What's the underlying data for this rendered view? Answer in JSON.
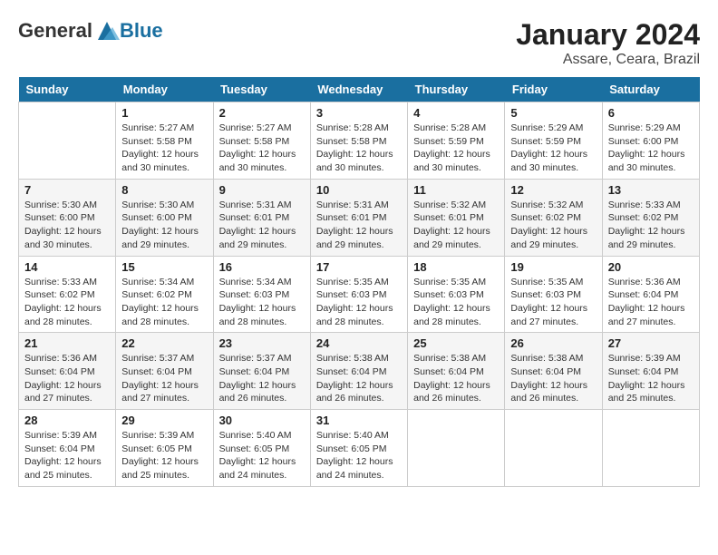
{
  "header": {
    "logo_general": "General",
    "logo_blue": "Blue",
    "month_year": "January 2024",
    "location": "Assare, Ceara, Brazil"
  },
  "days_of_week": [
    "Sunday",
    "Monday",
    "Tuesday",
    "Wednesday",
    "Thursday",
    "Friday",
    "Saturday"
  ],
  "weeks": [
    [
      {
        "day": "",
        "info": ""
      },
      {
        "day": "1",
        "info": "Sunrise: 5:27 AM\nSunset: 5:58 PM\nDaylight: 12 hours and 30 minutes."
      },
      {
        "day": "2",
        "info": "Sunrise: 5:27 AM\nSunset: 5:58 PM\nDaylight: 12 hours and 30 minutes."
      },
      {
        "day": "3",
        "info": "Sunrise: 5:28 AM\nSunset: 5:58 PM\nDaylight: 12 hours and 30 minutes."
      },
      {
        "day": "4",
        "info": "Sunrise: 5:28 AM\nSunset: 5:59 PM\nDaylight: 12 hours and 30 minutes."
      },
      {
        "day": "5",
        "info": "Sunrise: 5:29 AM\nSunset: 5:59 PM\nDaylight: 12 hours and 30 minutes."
      },
      {
        "day": "6",
        "info": "Sunrise: 5:29 AM\nSunset: 6:00 PM\nDaylight: 12 hours and 30 minutes."
      }
    ],
    [
      {
        "day": "7",
        "info": "Sunrise: 5:30 AM\nSunset: 6:00 PM\nDaylight: 12 hours and 30 minutes."
      },
      {
        "day": "8",
        "info": "Sunrise: 5:30 AM\nSunset: 6:00 PM\nDaylight: 12 hours and 29 minutes."
      },
      {
        "day": "9",
        "info": "Sunrise: 5:31 AM\nSunset: 6:01 PM\nDaylight: 12 hours and 29 minutes."
      },
      {
        "day": "10",
        "info": "Sunrise: 5:31 AM\nSunset: 6:01 PM\nDaylight: 12 hours and 29 minutes."
      },
      {
        "day": "11",
        "info": "Sunrise: 5:32 AM\nSunset: 6:01 PM\nDaylight: 12 hours and 29 minutes."
      },
      {
        "day": "12",
        "info": "Sunrise: 5:32 AM\nSunset: 6:02 PM\nDaylight: 12 hours and 29 minutes."
      },
      {
        "day": "13",
        "info": "Sunrise: 5:33 AM\nSunset: 6:02 PM\nDaylight: 12 hours and 29 minutes."
      }
    ],
    [
      {
        "day": "14",
        "info": "Sunrise: 5:33 AM\nSunset: 6:02 PM\nDaylight: 12 hours and 28 minutes."
      },
      {
        "day": "15",
        "info": "Sunrise: 5:34 AM\nSunset: 6:02 PM\nDaylight: 12 hours and 28 minutes."
      },
      {
        "day": "16",
        "info": "Sunrise: 5:34 AM\nSunset: 6:03 PM\nDaylight: 12 hours and 28 minutes."
      },
      {
        "day": "17",
        "info": "Sunrise: 5:35 AM\nSunset: 6:03 PM\nDaylight: 12 hours and 28 minutes."
      },
      {
        "day": "18",
        "info": "Sunrise: 5:35 AM\nSunset: 6:03 PM\nDaylight: 12 hours and 28 minutes."
      },
      {
        "day": "19",
        "info": "Sunrise: 5:35 AM\nSunset: 6:03 PM\nDaylight: 12 hours and 27 minutes."
      },
      {
        "day": "20",
        "info": "Sunrise: 5:36 AM\nSunset: 6:04 PM\nDaylight: 12 hours and 27 minutes."
      }
    ],
    [
      {
        "day": "21",
        "info": "Sunrise: 5:36 AM\nSunset: 6:04 PM\nDaylight: 12 hours and 27 minutes."
      },
      {
        "day": "22",
        "info": "Sunrise: 5:37 AM\nSunset: 6:04 PM\nDaylight: 12 hours and 27 minutes."
      },
      {
        "day": "23",
        "info": "Sunrise: 5:37 AM\nSunset: 6:04 PM\nDaylight: 12 hours and 26 minutes."
      },
      {
        "day": "24",
        "info": "Sunrise: 5:38 AM\nSunset: 6:04 PM\nDaylight: 12 hours and 26 minutes."
      },
      {
        "day": "25",
        "info": "Sunrise: 5:38 AM\nSunset: 6:04 PM\nDaylight: 12 hours and 26 minutes."
      },
      {
        "day": "26",
        "info": "Sunrise: 5:38 AM\nSunset: 6:04 PM\nDaylight: 12 hours and 26 minutes."
      },
      {
        "day": "27",
        "info": "Sunrise: 5:39 AM\nSunset: 6:04 PM\nDaylight: 12 hours and 25 minutes."
      }
    ],
    [
      {
        "day": "28",
        "info": "Sunrise: 5:39 AM\nSunset: 6:04 PM\nDaylight: 12 hours and 25 minutes."
      },
      {
        "day": "29",
        "info": "Sunrise: 5:39 AM\nSunset: 6:05 PM\nDaylight: 12 hours and 25 minutes."
      },
      {
        "day": "30",
        "info": "Sunrise: 5:40 AM\nSunset: 6:05 PM\nDaylight: 12 hours and 24 minutes."
      },
      {
        "day": "31",
        "info": "Sunrise: 5:40 AM\nSunset: 6:05 PM\nDaylight: 12 hours and 24 minutes."
      },
      {
        "day": "",
        "info": ""
      },
      {
        "day": "",
        "info": ""
      },
      {
        "day": "",
        "info": ""
      }
    ]
  ]
}
